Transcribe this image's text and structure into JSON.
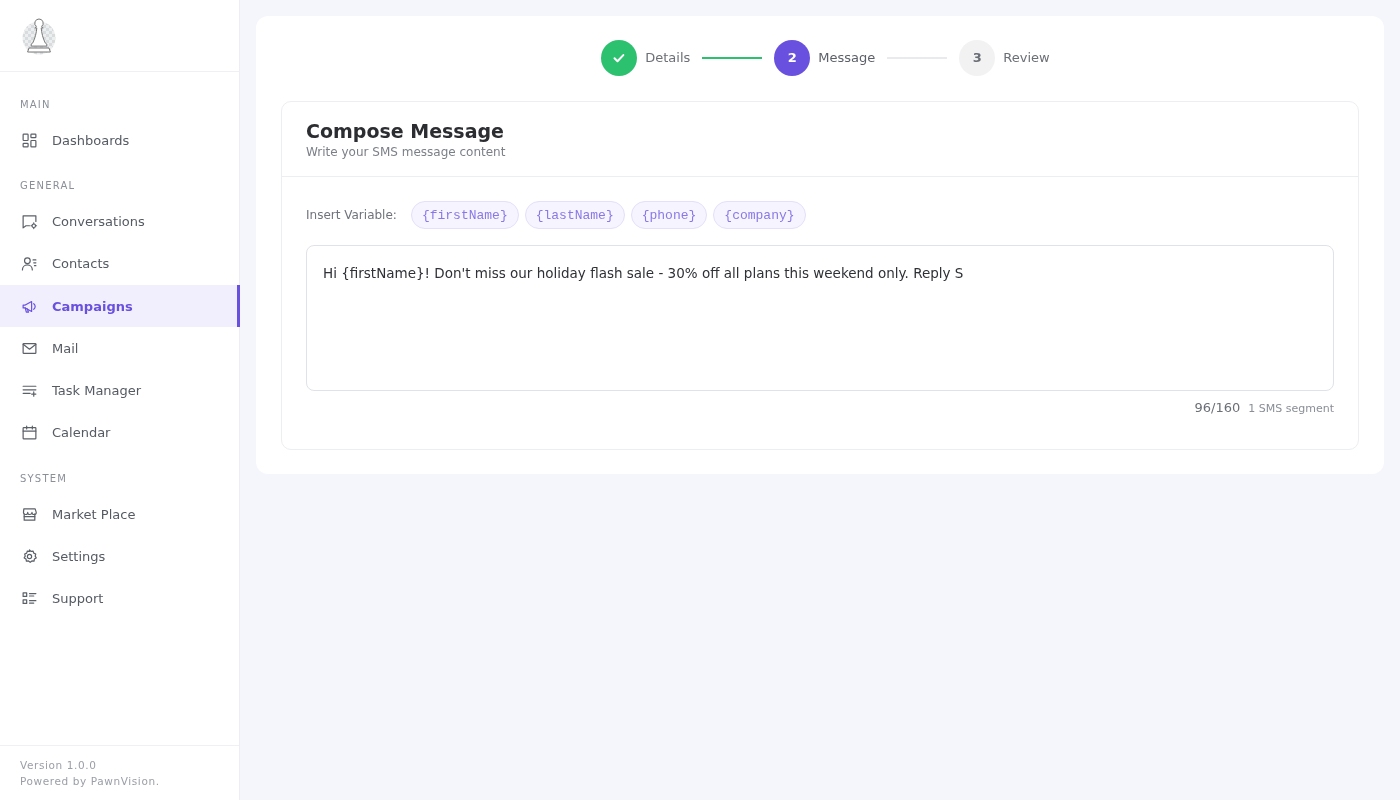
{
  "sidebar": {
    "sections": [
      {
        "label": "MAIN",
        "items": [
          {
            "label": "Dashboards",
            "selected": false
          }
        ]
      },
      {
        "label": "GENERAL",
        "items": [
          {
            "label": "Conversations",
            "selected": false
          },
          {
            "label": "Contacts",
            "selected": false
          },
          {
            "label": "Campaigns",
            "selected": true
          },
          {
            "label": "Mail",
            "selected": false
          },
          {
            "label": "Task Manager",
            "selected": false
          },
          {
            "label": "Calendar",
            "selected": false
          }
        ]
      },
      {
        "label": "SYSTEM",
        "items": [
          {
            "label": "Market Place",
            "selected": false
          },
          {
            "label": "Settings",
            "selected": false
          },
          {
            "label": "Support",
            "selected": false
          }
        ]
      }
    ],
    "footer": {
      "version": "Version 1.0.0",
      "powered_by": "Powered by PawnVision."
    }
  },
  "stepper": [
    {
      "label": "Details",
      "done": true,
      "selected": false
    },
    {
      "number": "2",
      "label": "Message",
      "done": false,
      "selected": true
    },
    {
      "number": "3",
      "label": "Review",
      "done": false,
      "selected": false
    }
  ],
  "compose": {
    "title": "Compose Message",
    "subtitle": "Write your SMS message content",
    "insert_label": "Insert Variable:",
    "variables": [
      "{firstName}",
      "{lastName}",
      "{phone}",
      "{company}"
    ],
    "message": {
      "value": "Hi {firstName}! Don't miss our holiday flash sale - 30% off all plans this weekend only. Reply S"
    },
    "char_count": "96/160",
    "segments": "1 SMS segment"
  }
}
